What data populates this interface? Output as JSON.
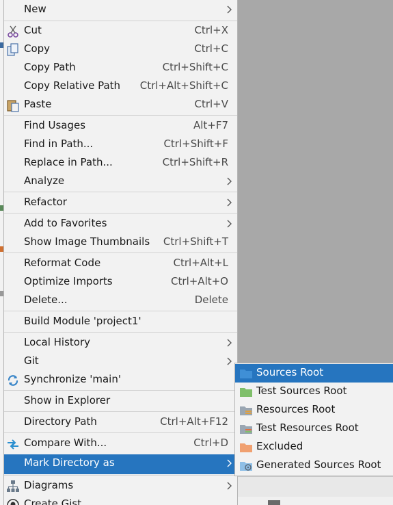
{
  "menu": {
    "items": [
      {
        "label": "New",
        "shortcut": "",
        "submenu": true
      },
      {
        "label": "Cut",
        "shortcut": "Ctrl+X",
        "icon": "scissors-icon"
      },
      {
        "label": "Copy",
        "shortcut": "Ctrl+C",
        "icon": "copy-icon"
      },
      {
        "label": "Copy Path",
        "shortcut": "Ctrl+Shift+C"
      },
      {
        "label": "Copy Relative Path",
        "shortcut": "Ctrl+Alt+Shift+C"
      },
      {
        "label": "Paste",
        "shortcut": "Ctrl+V",
        "icon": "paste-icon"
      },
      {
        "label": "Find Usages",
        "shortcut": "Alt+F7"
      },
      {
        "label": "Find in Path...",
        "shortcut": "Ctrl+Shift+F"
      },
      {
        "label": "Replace in Path...",
        "shortcut": "Ctrl+Shift+R"
      },
      {
        "label": "Analyze",
        "shortcut": "",
        "submenu": true
      },
      {
        "label": "Refactor",
        "shortcut": "",
        "submenu": true
      },
      {
        "label": "Add to Favorites",
        "shortcut": "",
        "submenu": true
      },
      {
        "label": "Show Image Thumbnails",
        "shortcut": "Ctrl+Shift+T"
      },
      {
        "label": "Reformat Code",
        "shortcut": "Ctrl+Alt+L"
      },
      {
        "label": "Optimize Imports",
        "shortcut": "Ctrl+Alt+O"
      },
      {
        "label": "Delete...",
        "shortcut": "Delete"
      },
      {
        "label": "Build Module 'project1'",
        "shortcut": ""
      },
      {
        "label": "Local History",
        "shortcut": "",
        "submenu": true
      },
      {
        "label": "Git",
        "shortcut": "",
        "submenu": true
      },
      {
        "label": "Synchronize 'main'",
        "shortcut": "",
        "icon": "sync-icon"
      },
      {
        "label": "Show in Explorer",
        "shortcut": ""
      },
      {
        "label": "Directory Path",
        "shortcut": "Ctrl+Alt+F12"
      },
      {
        "label": "Compare With...",
        "shortcut": "Ctrl+D",
        "icon": "compare-icon"
      },
      {
        "label": "Mark Directory as",
        "shortcut": "",
        "submenu": true,
        "selected": true
      },
      {
        "label": "Diagrams",
        "shortcut": "",
        "submenu": true,
        "icon": "diagram-icon"
      },
      {
        "label": "Create Gist",
        "shortcut": "",
        "icon": "github-icon"
      }
    ]
  },
  "submenu": {
    "items": [
      {
        "label": "Sources Root",
        "icon": "sources-root-folder-icon",
        "selected": true
      },
      {
        "label": "Test Sources Root",
        "icon": "test-sources-root-folder-icon"
      },
      {
        "label": "Resources Root",
        "icon": "resources-root-folder-icon"
      },
      {
        "label": "Test Resources Root",
        "icon": "test-resources-root-folder-icon"
      },
      {
        "label": "Excluded",
        "icon": "excluded-folder-icon"
      },
      {
        "label": "Generated Sources Root",
        "icon": "generated-sources-root-folder-icon"
      }
    ]
  },
  "colors": {
    "selection": "#2675bf",
    "menu_background": "#f2f2f2",
    "sources_folder": "#3f8fd6",
    "test_sources_folder": "#7fbf6a",
    "excluded_folder": "#f0a070"
  }
}
